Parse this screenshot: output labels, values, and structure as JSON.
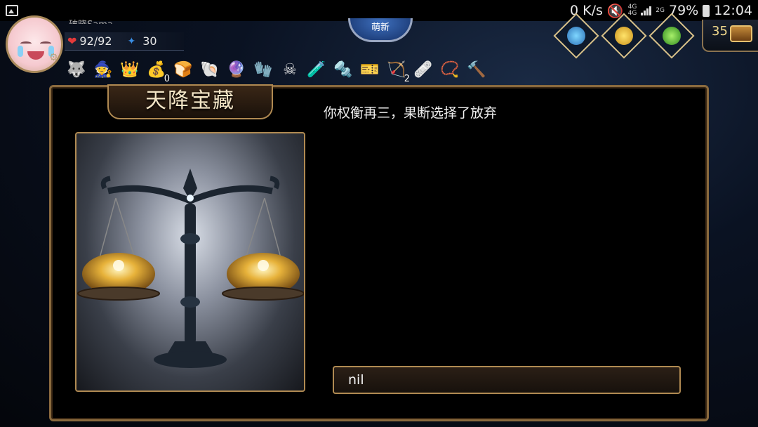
{
  "statusbar": {
    "net_speed": "0 K/s",
    "signal1": "4G",
    "signal2": "4G",
    "signal3": "2G",
    "battery": "79%",
    "time": "12:04"
  },
  "player": {
    "name": "破晓Sama",
    "hp": "92/92",
    "mana": "30"
  },
  "badge": {
    "label": "萌新"
  },
  "chest": {
    "count": "35"
  },
  "buffs": [
    {
      "icon": "husky-icon",
      "glyph": "🐺",
      "count": ""
    },
    {
      "icon": "hood-mage-icon",
      "glyph": "🧙",
      "count": ""
    },
    {
      "icon": "crown-icon",
      "glyph": "👑",
      "count": ""
    },
    {
      "icon": "coin-pocket-icon",
      "glyph": "💰",
      "count": "0"
    },
    {
      "icon": "bread-icon",
      "glyph": "🍞",
      "count": ""
    },
    {
      "icon": "shell-icon",
      "glyph": "🐚",
      "count": ""
    },
    {
      "icon": "blue-orb-icon",
      "glyph": "🔮",
      "count": ""
    },
    {
      "icon": "gauntlet-icon",
      "glyph": "🧤",
      "count": ""
    },
    {
      "icon": "pirate-skull-icon",
      "glyph": "☠",
      "count": ""
    },
    {
      "icon": "potion-icon",
      "glyph": "🧪",
      "count": ""
    },
    {
      "icon": "drill-icon",
      "glyph": "🔩",
      "count": ""
    },
    {
      "icon": "vip-card-icon",
      "glyph": "🎫",
      "count": ""
    },
    {
      "icon": "bow-icon",
      "glyph": "🏹",
      "count": "2"
    },
    {
      "icon": "medkit-icon",
      "glyph": "🩹",
      "count": ""
    },
    {
      "icon": "collar-icon",
      "glyph": "📿",
      "count": ""
    },
    {
      "icon": "hammer-icon",
      "glyph": "🔨",
      "count": ""
    }
  ],
  "event": {
    "title": "天降宝藏",
    "message": "你权衡再三，果断选择了放弃",
    "choice": "nil"
  }
}
